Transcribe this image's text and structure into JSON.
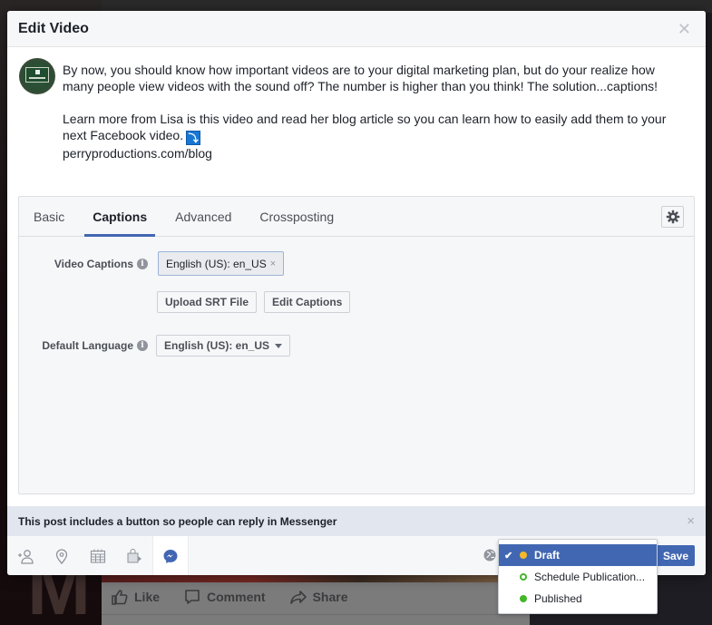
{
  "dialog": {
    "title": "Edit Video",
    "close_icon": "close-icon"
  },
  "post": {
    "avatar_alt": "Page avatar",
    "paragraph1_line1": "By now, you should know how important videos are to your digital marketing plan, but do your realize how",
    "paragraph1_line2": "many people view videos with the sound off? The number is higher than you think! The solution...captions!",
    "paragraph2_line1": "Learn more from Lisa is this video and read her blog article so you can learn how to easily add them to your",
    "paragraph2_line2": "next Facebook video.",
    "emoji": "⤵",
    "link": "perryproductions.com/blog"
  },
  "tabs": [
    {
      "label": "Basic",
      "active": false
    },
    {
      "label": "Captions",
      "active": true
    },
    {
      "label": "Advanced",
      "active": false
    },
    {
      "label": "Crossposting",
      "active": false
    }
  ],
  "captions": {
    "video_captions_label": "Video Captions",
    "video_captions_token": "English (US): en_US",
    "token_remove": "×",
    "upload_button": "Upload SRT File",
    "edit_button": "Edit Captions",
    "default_language_label": "Default Language",
    "default_language_value": "English (US): en_US",
    "info_glyph": "i"
  },
  "notice": {
    "text": "This post includes a button so people can reply in Messenger",
    "close": "×"
  },
  "footer": {
    "icons": [
      "tag-people-icon",
      "location-icon",
      "calendar-icon",
      "shopping-bag-icon",
      "messenger-icon"
    ],
    "active_icon": "messenger-icon",
    "save_label": "Save"
  },
  "publish_menu": {
    "items": [
      {
        "label": "Draft",
        "selected": true,
        "dot_color": "#f7b928",
        "dot_style": "filled"
      },
      {
        "label": "Schedule Publication...",
        "selected": false,
        "dot_color": "#42b72a",
        "dot_style": "ring"
      },
      {
        "label": "Published",
        "selected": false,
        "dot_color": "#42b72a",
        "dot_style": "filled"
      }
    ],
    "check_glyph": "✔"
  },
  "background_post": {
    "like": "Like",
    "comment": "Comment",
    "share": "Share",
    "big_letter": "M"
  },
  "colors": {
    "accent": "#4267b2",
    "notice_bg": "#e1e6ef",
    "panel_bg": "#f6f7f9"
  }
}
